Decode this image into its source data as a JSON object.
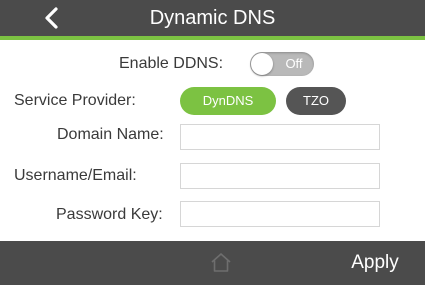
{
  "header": {
    "title": "Dynamic DNS",
    "back_icon": "chevron-left-icon"
  },
  "ddns": {
    "label": "Enable DDNS:",
    "toggle_state": "Off",
    "enabled": false
  },
  "provider": {
    "label": "Service Provider:",
    "options": [
      "DynDNS",
      "TZO"
    ],
    "selected": "DynDNS"
  },
  "fields": {
    "domain_label": "Domain Name:",
    "domain_value": "",
    "username_label": "Username/Email:",
    "username_value": "",
    "password_label": "Password Key:",
    "password_value": ""
  },
  "footer": {
    "home_icon": "home-icon",
    "apply_label": "Apply"
  },
  "colors": {
    "header_bg": "#4b4b4b",
    "accent": "#7cc242",
    "toggle_off": "#b9b9b9",
    "unselected_pill": "#555555"
  }
}
